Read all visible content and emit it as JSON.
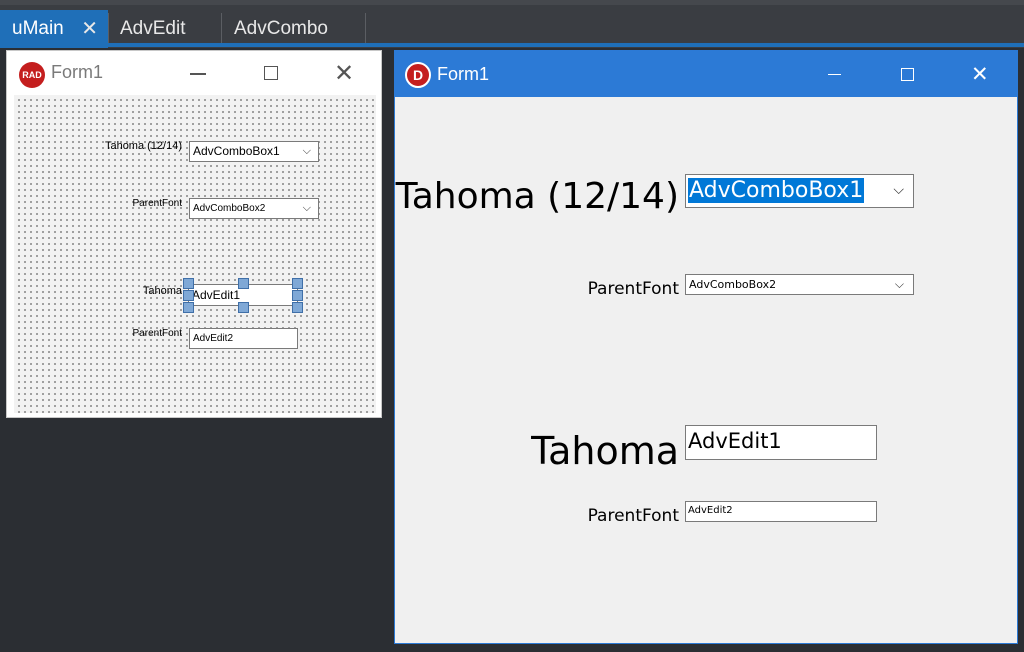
{
  "tabs": [
    {
      "label": "uMain",
      "active": true,
      "close_icon": "close-icon"
    },
    {
      "label": "AdvEdit",
      "active": false
    },
    {
      "label": "AdvCombo",
      "active": false
    }
  ],
  "designer": {
    "title": "Form1",
    "logo_text": "RAD",
    "label_tahoma_1214": "Tahoma (12/14)",
    "combo1": "AdvComboBox1",
    "label_parentfont_1": "ParentFont",
    "combo2": "AdvComboBox2",
    "label_tahoma": "Tahoma",
    "edit1": "AdvEdit1",
    "label_parentfont_2": "ParentFont",
    "edit2": "AdvEdit2"
  },
  "runtime": {
    "title": "Form1",
    "logo_text": "D",
    "label_tahoma_1214": "Tahoma (12/14)",
    "combo1": "AdvComboBox1",
    "label_parentfont_1": "ParentFont",
    "combo2": "AdvComboBox2",
    "label_tahoma": "Tahoma",
    "edit1": "AdvEdit1",
    "label_parentfont_2": "ParentFont",
    "edit2": "AdvEdit2"
  },
  "colors": {
    "accent": "#1f6fb8",
    "titlebar": "#2c7ad6",
    "selection": "#0078d7",
    "ide_background": "#2b2e33"
  },
  "icons": {
    "chevron": "chevron-down-icon",
    "minimize": "minimize-icon",
    "maximize": "maximize-icon",
    "close": "close-icon"
  }
}
